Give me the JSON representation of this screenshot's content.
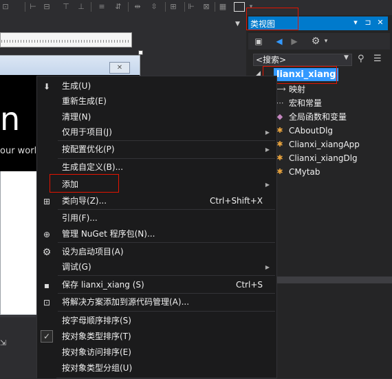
{
  "class_view": {
    "title": "类视图",
    "title_buttons": [
      "▾",
      "⊐",
      "✕"
    ],
    "search_placeholder": "<搜索>",
    "root": "lianxi_xiang",
    "items": [
      {
        "label": "映射",
        "icon": "map-icon"
      },
      {
        "label": "宏和常量",
        "icon": "macro-icon"
      },
      {
        "label": "全局函数和变量",
        "icon": "global-functions-icon"
      },
      {
        "label": "CAboutDlg",
        "icon": "class-icon"
      },
      {
        "label": "Clianxi_xiangApp",
        "icon": "class-icon"
      },
      {
        "label": "Clianxi_xiangDlg",
        "icon": "class-icon"
      },
      {
        "label": "CMytab",
        "icon": "class-icon"
      }
    ]
  },
  "editor": {
    "splash_letter": "n",
    "splash_text": "our world"
  },
  "context_menu": {
    "items": [
      {
        "label": "生成(U)",
        "icon": "build-icon"
      },
      {
        "label": "重新生成(E)"
      },
      {
        "label": "清理(N)"
      },
      {
        "label": "仅用于项目(J)",
        "submenu": true
      },
      {
        "label": "按配置优化(P)",
        "submenu": true
      },
      {
        "label": "生成自定义(B)..."
      },
      {
        "label": "添加",
        "submenu": true
      },
      {
        "label": "类向导(Z)...",
        "shortcut": "Ctrl+Shift+X",
        "icon": "class-wizard-icon"
      },
      {
        "label": "引用(F)..."
      },
      {
        "label": "管理 NuGet 程序包(N)...",
        "icon": "nuget-icon"
      },
      {
        "label": "设为启动项目(A)",
        "icon": "gear-icon"
      },
      {
        "label": "调试(G)",
        "submenu": true
      },
      {
        "label": "保存 lianxi_xiang (S)",
        "shortcut": "Ctrl+S",
        "icon": "save-icon"
      },
      {
        "label": "将解决方案添加到源代码管理(A)...",
        "icon": "source-control-icon"
      },
      {
        "label": "按字母顺序排序(S)"
      },
      {
        "label": "按对象类型排序(T)",
        "checked": true
      },
      {
        "label": "按对象访问排序(E)"
      },
      {
        "label": "按对象类型分组(U)"
      }
    ]
  },
  "colors": {
    "accent": "#007acc",
    "selection": "#3399ff",
    "highlight_box": "#e51400",
    "menu_bg": "#1b1b1c",
    "panel_bg": "#252526"
  }
}
